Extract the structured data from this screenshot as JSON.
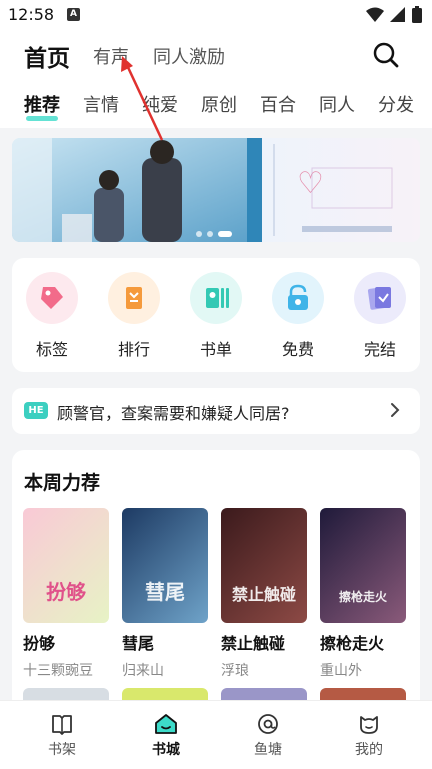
{
  "status": {
    "time": "12:58",
    "notif": "A"
  },
  "top_nav": {
    "tabs": [
      "首页",
      "有声",
      "同人激励"
    ],
    "active": "首页"
  },
  "category_tabs": [
    "推荐",
    "言情",
    "纯爱",
    "原创",
    "百合",
    "同人",
    "分发"
  ],
  "quick_actions": [
    {
      "label": "标签",
      "icon": "tag-icon",
      "bg": "#fde9ee",
      "color": "#f26b8a"
    },
    {
      "label": "排行",
      "icon": "ranking-icon",
      "bg": "#fff0e0",
      "color": "#f59a3c"
    },
    {
      "label": "书单",
      "icon": "booklist-icon",
      "bg": "#e2f8f5",
      "color": "#33c9b4"
    },
    {
      "label": "免费",
      "icon": "free-icon",
      "bg": "#e2f4fc",
      "color": "#3fb4e8"
    },
    {
      "label": "完结",
      "icon": "finished-icon",
      "bg": "#ecebfb",
      "color": "#7a78e0"
    }
  ],
  "notice": {
    "badge": "HE",
    "text": "顾警官，查案需要和嫌疑人同居?"
  },
  "recommend": {
    "title": "本周力荐",
    "books": [
      {
        "title": "扮够",
        "author": "十三颗豌豆",
        "cover_text": "扮够",
        "cover_from": "#f9c9d6",
        "cover_to": "#e7f3c5"
      },
      {
        "title": "彗尾",
        "author": "归来山",
        "cover_text": "彗尾",
        "cover_from": "#1d3a63",
        "cover_to": "#6fa3c9"
      },
      {
        "title": "禁止触碰",
        "author": "浮琅",
        "cover_text": "禁止触碰",
        "cover_from": "#3b1a1c",
        "cover_to": "#8d4a45"
      },
      {
        "title": "擦枪走火",
        "author": "重山外",
        "cover_text": "擦枪走火",
        "cover_from": "#1f1a3a",
        "cover_to": "#8a5a7a"
      }
    ]
  },
  "bottom_nav": [
    {
      "label": "书架",
      "icon": "bookshelf-icon"
    },
    {
      "label": "书城",
      "icon": "bookstore-icon"
    },
    {
      "label": "鱼塘",
      "icon": "fishpond-icon"
    },
    {
      "label": "我的",
      "icon": "profile-icon"
    }
  ],
  "bottom_nav_active": "书城",
  "colors": {
    "accent": "#3ddbc9",
    "annotation": "#e0322f"
  }
}
